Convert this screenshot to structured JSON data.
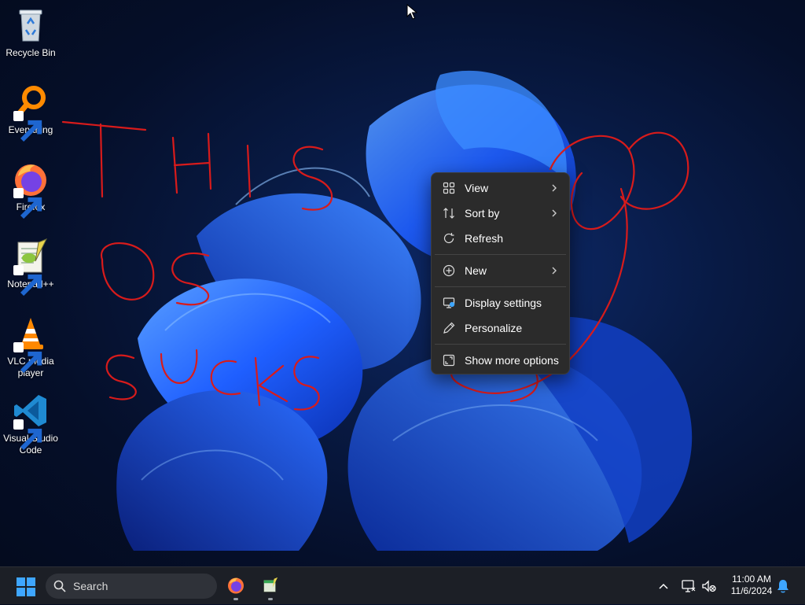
{
  "desktop": {
    "icons": [
      {
        "label": "Recycle Bin",
        "icon": "recycle-bin-icon",
        "shortcut": false
      },
      {
        "label": "Everything",
        "icon": "everything-search-icon",
        "shortcut": true
      },
      {
        "label": "Firefox",
        "icon": "firefox-icon",
        "shortcut": true
      },
      {
        "label": "Notepad++",
        "icon": "notepad-plus-plus-icon",
        "shortcut": true
      },
      {
        "label": "VLC media player",
        "icon": "vlc-cone-icon",
        "shortcut": true
      },
      {
        "label": "Visual Studio Code",
        "icon": "vscode-icon",
        "shortcut": true
      }
    ],
    "annotation_text": "THIS OS SUCKS",
    "annotation_color": "#d81b1b"
  },
  "context_menu": {
    "items": [
      {
        "label": "View",
        "icon": "grid-icon",
        "submenu": true
      },
      {
        "label": "Sort by",
        "icon": "sort-icon",
        "submenu": true
      },
      {
        "label": "Refresh",
        "icon": "refresh-icon",
        "submenu": false
      },
      {
        "label": "New",
        "icon": "plus-circle-icon",
        "submenu": true
      },
      {
        "label": "Display settings",
        "icon": "display-icon",
        "submenu": false
      },
      {
        "label": "Personalize",
        "icon": "pen-icon",
        "submenu": false
      },
      {
        "label": "Show more options",
        "icon": "expand-icon",
        "submenu": false
      }
    ]
  },
  "taskbar": {
    "search_placeholder": "Search",
    "pinned_apps": [
      {
        "name": "Firefox",
        "icon": "firefox-icon",
        "running": true
      },
      {
        "name": "Notepad++",
        "icon": "notepad-plus-plus-icon",
        "running": true
      }
    ],
    "clock": {
      "time": "11:00 AM",
      "date": "11/6/2024"
    },
    "tray_icons": [
      "chevron-up-icon",
      "network-icon",
      "volume-muted-icon",
      "notification-bell-icon"
    ],
    "accent_color": "#3ea6ff"
  }
}
